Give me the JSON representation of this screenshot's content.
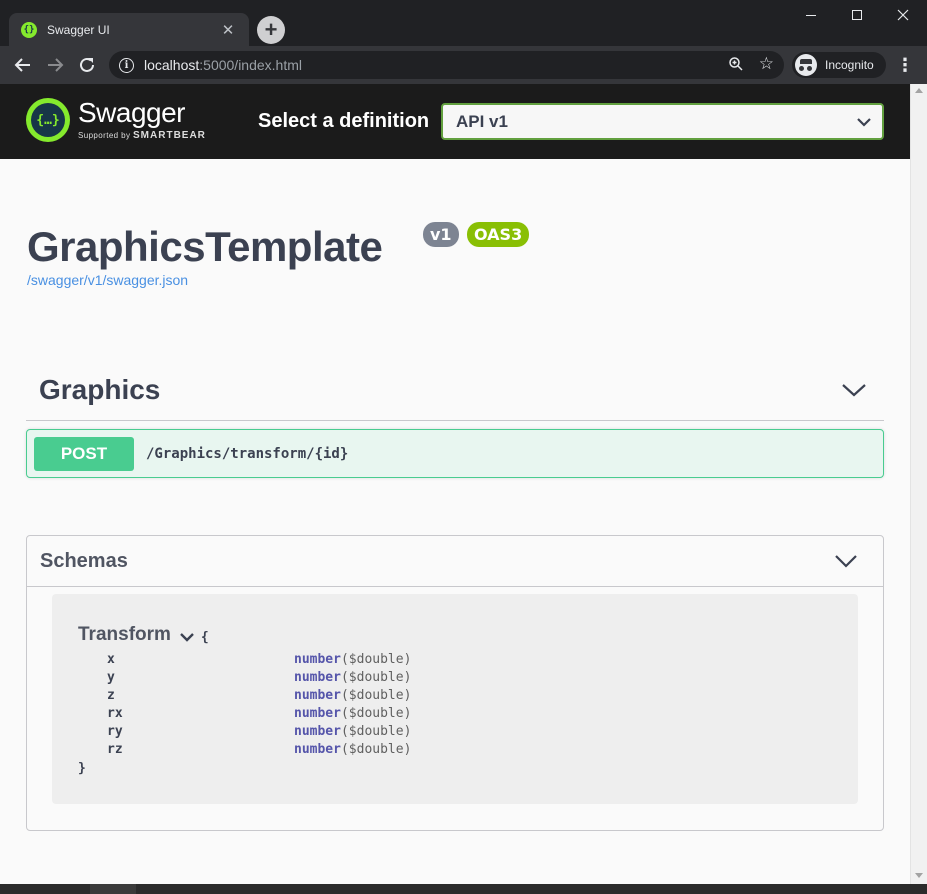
{
  "browser": {
    "tab_title": "Swagger UI",
    "tab_close": "✕",
    "new_tab": "+",
    "url_host": "localhost",
    "url_rest": ":5000/index.html",
    "incognito_label": "Incognito",
    "icons": {
      "back": "back-arrow-icon",
      "forward": "forward-arrow-icon",
      "reload": "reload-icon",
      "info": "info-icon",
      "zoom": "zoom-icon",
      "bookmark": "star-icon",
      "menu": "kebab-menu-icon"
    }
  },
  "swagger": {
    "logo_name": "Swagger",
    "logo_supported_by": "Supported by",
    "logo_company": "SMARTBEAR",
    "select_label": "Select a definition",
    "selected_definition": "API v1",
    "title": "GraphicsTemplate",
    "version_badge": "v1",
    "oas_badge": "OAS3",
    "spec_link": "/swagger/v1/swagger.json",
    "colors": {
      "brand_green": "#85ea2d",
      "post_green": "#49cc90",
      "badge_grey": "#7d8492",
      "oas_green": "#89bf04",
      "link_blue": "#4990e2"
    }
  },
  "tag": {
    "name": "Graphics",
    "operations": [
      {
        "method": "POST",
        "path": "/Graphics/transform/{id}"
      }
    ]
  },
  "schemas": {
    "title": "Schemas",
    "models": [
      {
        "name": "Transform",
        "open_brace": "{",
        "close_brace": "}",
        "properties": [
          {
            "name": "x",
            "type": "number",
            "format": "($double)"
          },
          {
            "name": "y",
            "type": "number",
            "format": "($double)"
          },
          {
            "name": "z",
            "type": "number",
            "format": "($double)"
          },
          {
            "name": "rx",
            "type": "number",
            "format": "($double)"
          },
          {
            "name": "ry",
            "type": "number",
            "format": "($double)"
          },
          {
            "name": "rz",
            "type": "number",
            "format": "($double)"
          }
        ]
      }
    ]
  }
}
